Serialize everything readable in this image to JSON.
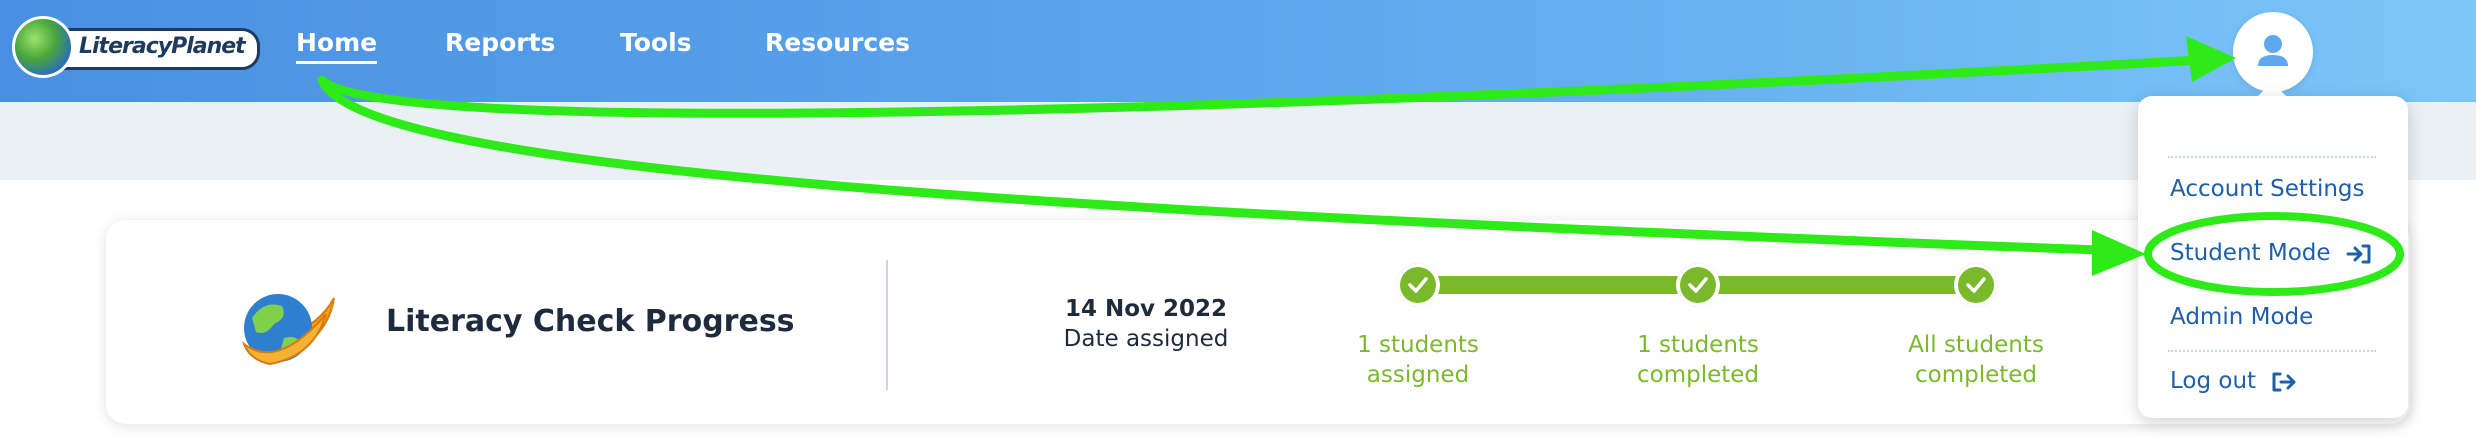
{
  "brand": {
    "logo_text": "LiteracyPlanet"
  },
  "nav": {
    "items": [
      {
        "label": "Home",
        "active": true
      },
      {
        "label": "Reports"
      },
      {
        "label": "Tools"
      },
      {
        "label": "Resources"
      }
    ]
  },
  "user_menu": {
    "icon": "user-icon",
    "items": [
      {
        "label": "Account Settings"
      },
      {
        "label": "Student Mode",
        "icon": "sign-in-icon"
      },
      {
        "label": "Admin Mode"
      },
      {
        "label": "Log out",
        "icon": "sign-out-icon"
      }
    ]
  },
  "card": {
    "title": "Literacy Check Progress",
    "date_value": "14 Nov 2022",
    "date_label": "Date assigned",
    "steps": [
      {
        "line1": "1 students",
        "line2": "assigned"
      },
      {
        "line1": "1 students",
        "line2": "completed"
      },
      {
        "line1": "All students",
        "line2": "completed"
      }
    ]
  },
  "colors": {
    "nav_gradient_start": "#4a90e2",
    "nav_gradient_end": "#7cc6f8",
    "progress_green": "#7ab92b",
    "link_blue": "#1f5fa8",
    "annotation_green": "#2eea18"
  }
}
